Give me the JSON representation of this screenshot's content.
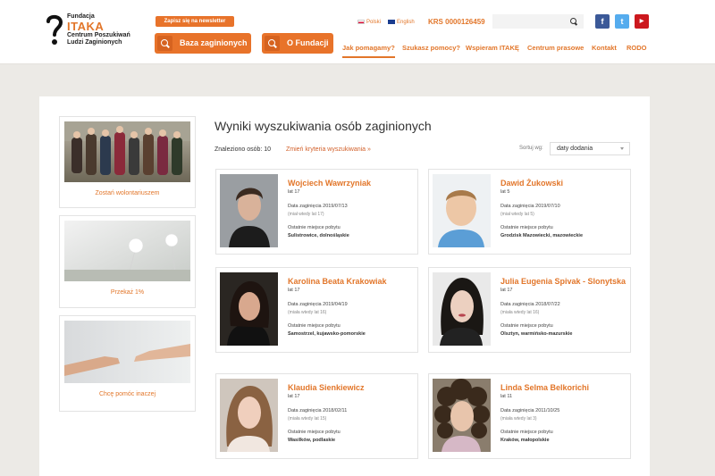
{
  "header": {
    "logo": {
      "line1": "Fundacja",
      "line2": "ITAKA",
      "line3": "Centrum Poszukiwań",
      "line4": "Ludzi Zaginionych"
    },
    "newsletter": "Zapisz się na newsletter",
    "buttons": [
      {
        "label": "Baza zaginionych"
      },
      {
        "label": "O Fundacji"
      }
    ],
    "languages": [
      {
        "label": "Polski"
      },
      {
        "label": "English"
      }
    ],
    "krs": "KRS 0000126459",
    "search": {
      "placeholder": ""
    },
    "social": [
      {
        "icon": "facebook-icon",
        "glyph": "f",
        "color": "#3b5998"
      },
      {
        "icon": "twitter-icon",
        "glyph": "t",
        "color": "#55acee"
      },
      {
        "icon": "youtube-icon",
        "glyph": "▶",
        "color": "#cc181e"
      }
    ],
    "nav": [
      {
        "label": "Jak pomagamy?"
      },
      {
        "label": "Szukasz pomocy?"
      },
      {
        "label": "Wspieram ITAKĘ"
      },
      {
        "label": "Centrum prasowe"
      },
      {
        "label": "Kontakt"
      },
      {
        "label": "RODO"
      }
    ]
  },
  "sidebar": [
    {
      "caption": "Zostań wolontariuszem"
    },
    {
      "caption": "Przekaż 1%"
    },
    {
      "caption": "Chcę pomóc inaczej"
    }
  ],
  "results": {
    "title": "Wyniki wyszukiwania osób zaginionych",
    "found_label": "Znaleziono osób:",
    "found_count": "10",
    "change_criteria": "Zmień kryteria wyszukiwania »",
    "sort_label": "Sortuj wg:",
    "sort_value": "daty dodania",
    "cards": [
      {
        "name": "Wojciech Wawrzyniak",
        "age": "lat 17",
        "date_label": "Data zaginięcia 2019/07/13",
        "then": "(miał wtedy lat 17)",
        "place_label": "Ostatnie miejsce pobytu",
        "place": "Sulistrowice, dolnośląskie"
      },
      {
        "name": "Dawid Żukowski",
        "age": "lat 5",
        "date_label": "Data zaginięcia 2019/07/10",
        "then": "(miał wtedy lat 5)",
        "place_label": "Ostatnie miejsce pobytu",
        "place": "Grodzisk Mazowiecki, mazowieckie"
      },
      {
        "name": "Karolina Beata Krakowiak",
        "age": "lat 17",
        "date_label": "Data zaginięcia 2019/04/19",
        "then": "(miała wtedy lat 16)",
        "place_label": "Ostatnie miejsce pobytu",
        "place": "Samostrzel, kujawsko-pomorskie"
      },
      {
        "name": "Julia Eugenia Spivak - Slonytska",
        "age": "lat 17",
        "date_label": "Data zaginięcia 2018/07/22",
        "then": "(miała wtedy lat 16)",
        "place_label": "Ostatnie miejsce pobytu",
        "place": "Olsztyn, warmińsko-mazurskie"
      },
      {
        "name": "Klaudia Sienkiewicz",
        "age": "lat 17",
        "date_label": "Data zaginięcia 2018/02/11",
        "then": "(miała wtedy lat 15)",
        "place_label": "Ostatnie miejsce pobytu",
        "place": "Wasilków, podlaskie"
      },
      {
        "name": "Linda Selma Belkorichi",
        "age": "lat 11",
        "date_label": "Data zaginięcia 2011/10/25",
        "then": "(miała wtedy lat 3)",
        "place_label": "Ostatnie miejsce pobytu",
        "place": "Kraków, małopolskie"
      }
    ]
  },
  "colors": {
    "accent": "#e2762a",
    "button": "#e8732a",
    "background": "#eceae6"
  }
}
